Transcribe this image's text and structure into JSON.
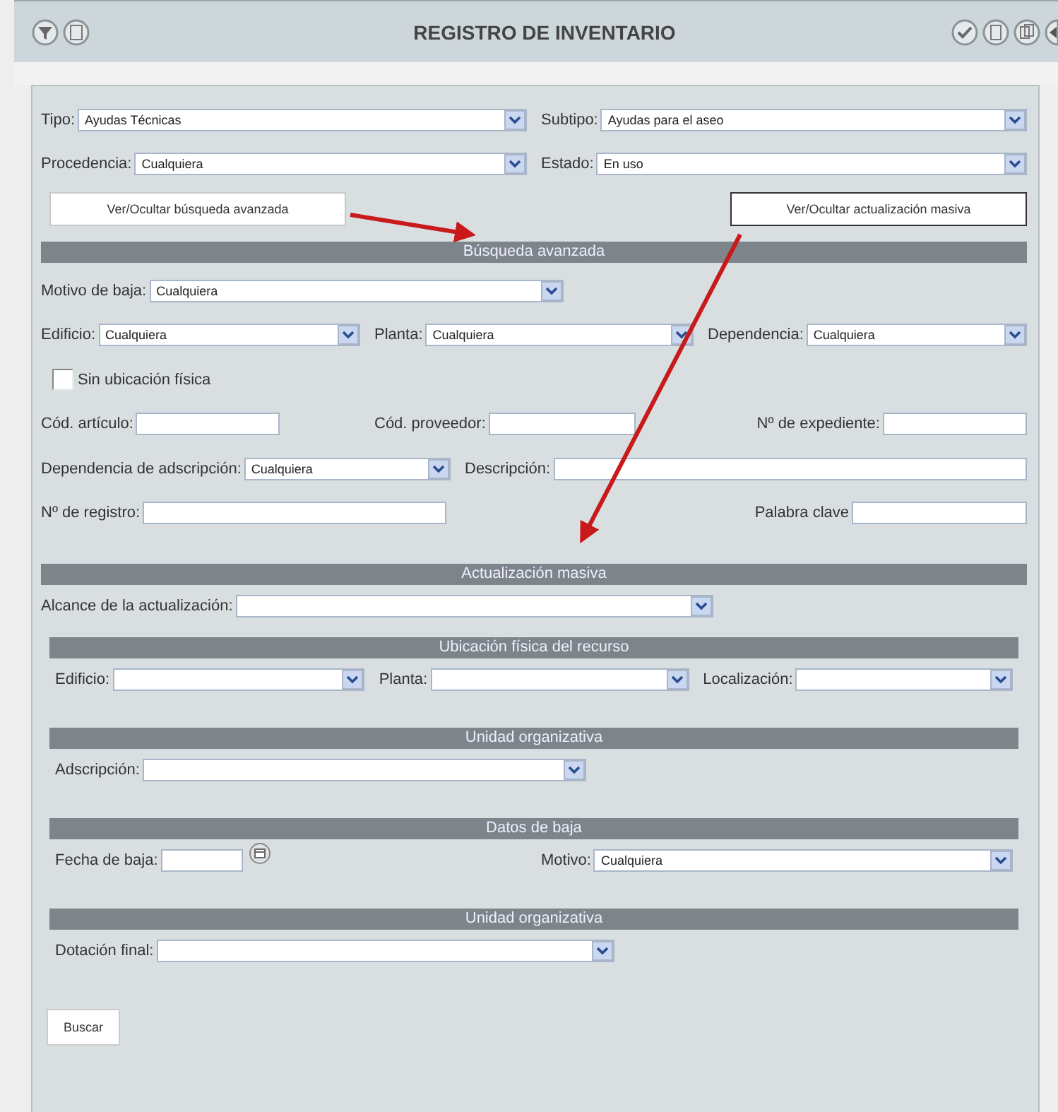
{
  "header": {
    "title": "REGISTRO DE INVENTARIO"
  },
  "top_rows": [
    [
      {
        "kind": "select",
        "label": "Tipo:",
        "value": "Ayudas Técnicas"
      },
      {
        "kind": "select",
        "label": "Subtipo:",
        "value": "Ayudas para el aseo"
      }
    ],
    [
      {
        "kind": "select",
        "label": "Procedencia:",
        "value": "Cualquiera"
      },
      {
        "kind": "select",
        "label": "Estado:",
        "value": "En uso"
      }
    ]
  ],
  "toggle_buttons": [
    {
      "label": "Ver/Ocultar búsqueda avanzada",
      "selected": false
    },
    {
      "label": "Ver/Ocultar actualización masiva",
      "selected": true
    }
  ],
  "advanced": {
    "title": "Búsqueda avanzada",
    "rows": [
      [
        {
          "kind": "select",
          "label": "Motivo de baja:",
          "value": "Cualquiera"
        }
      ],
      [
        {
          "kind": "select",
          "label": "Edificio:",
          "value": "Cualquiera"
        },
        {
          "kind": "select",
          "label": "Planta:",
          "value": "Cualquiera"
        },
        {
          "kind": "select",
          "label": "Dependencia:",
          "value": "Cualquiera"
        }
      ],
      [
        {
          "kind": "checkbox",
          "label": "Sin ubicación física",
          "checked": false
        }
      ],
      [
        {
          "kind": "text",
          "label": "Cód. artículo:"
        },
        {
          "kind": "text",
          "label": "Cód. proveedor:"
        },
        {
          "kind": "text",
          "label": "Nº de expediente:"
        }
      ],
      [
        {
          "kind": "select",
          "label": "Dependencia de adscripción:",
          "value": "Cualquiera"
        },
        {
          "kind": "text",
          "label": "Descripción:"
        }
      ],
      [
        {
          "kind": "text",
          "label": "Nº de registro:"
        },
        "",
        {
          "kind": "text",
          "label": "Palabra clave"
        }
      ]
    ]
  },
  "mass_update": {
    "title": "Actualización masiva",
    "rows": [
      [
        {
          "kind": "select",
          "label": "Alcance de la actualización:"
        }
      ]
    ],
    "subsections": [
      {
        "title": "Ubicación física del recurso",
        "rows": [
          [
            {
              "kind": "select",
              "label": "Edificio:"
            },
            {
              "kind": "select",
              "label": "Planta:"
            },
            {
              "kind": "select",
              "label": "Localización:"
            }
          ]
        ]
      },
      {
        "title": "Unidad organizativa",
        "rows": [
          [
            {
              "kind": "select",
              "label": "Adscripción:"
            }
          ]
        ]
      },
      {
        "title": "Datos de baja",
        "rows": [
          [
            {
              "kind": "date",
              "label": "Fecha de baja:"
            },
            {
              "kind": "select",
              "label": "Motivo:",
              "value": "Cualquiera"
            }
          ]
        ]
      },
      {
        "title": "Unidad organizativa",
        "rows": [
          [
            {
              "kind": "select",
              "label": "Dotación final:"
            }
          ]
        ]
      }
    ]
  },
  "search_button": {
    "label": "Buscar"
  }
}
